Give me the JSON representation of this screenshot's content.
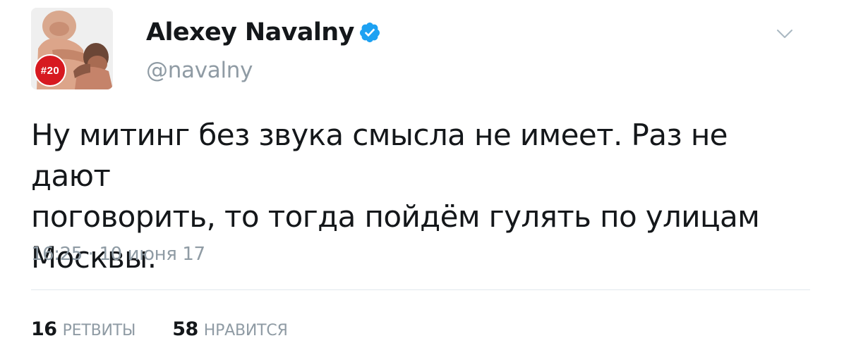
{
  "user": {
    "display_name": "Alexey Navalny",
    "handle": "@navalny",
    "verified": true,
    "avatar_badge": "#20"
  },
  "tweet": {
    "text": "Ну митинг без звука смысла не имеет. Раз не дают\nпоговорить, то тогда пойдём гулять по улицам\nМосквы.",
    "timestamp": "16:25 · 10 июня 17"
  },
  "stats": {
    "retweets": {
      "count": "16",
      "label": "РЕТВИТЫ"
    },
    "likes": {
      "count": "58",
      "label": "НРАВИТСЯ"
    }
  },
  "icons": {
    "verified": "verified-badge-icon",
    "menu": "chevron-down-icon"
  },
  "colors": {
    "text_primary": "#14171a",
    "text_secondary": "#8f9ba4",
    "verified_blue": "#1da1f2",
    "badge_red": "#d71920",
    "divider": "#e1e8ed"
  }
}
